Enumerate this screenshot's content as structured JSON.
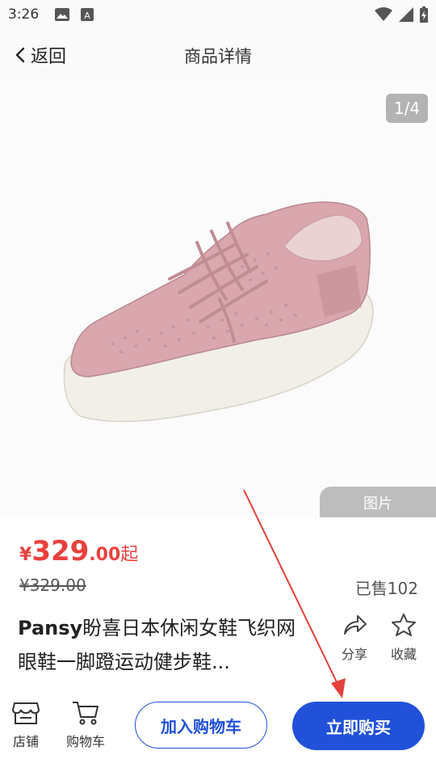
{
  "status_bar": {
    "time": "3:26"
  },
  "nav": {
    "back_label": "返回",
    "title": "商品详情"
  },
  "gallery": {
    "counter": "1/4",
    "media_tab": "图片"
  },
  "price": {
    "currency": "¥",
    "integer": "329",
    "decimal": ".00",
    "suffix": "起",
    "original": "¥329.00"
  },
  "sold": "已售102",
  "product": {
    "brand": "Pansy",
    "title": "盼喜日本休闲女鞋飞织网眼鞋一脚蹬运动健步鞋..."
  },
  "actions": {
    "share_label": "分享",
    "favorite_label": "收藏"
  },
  "bottom": {
    "store_label": "店铺",
    "cart_label": "购物车",
    "add_to_cart": "加入购物车",
    "buy_now": "立即购买"
  },
  "colors": {
    "accent": "#2151d9",
    "price": "#e8413d",
    "shoe": "#d9a7ad",
    "arrow": "#e5403a"
  }
}
